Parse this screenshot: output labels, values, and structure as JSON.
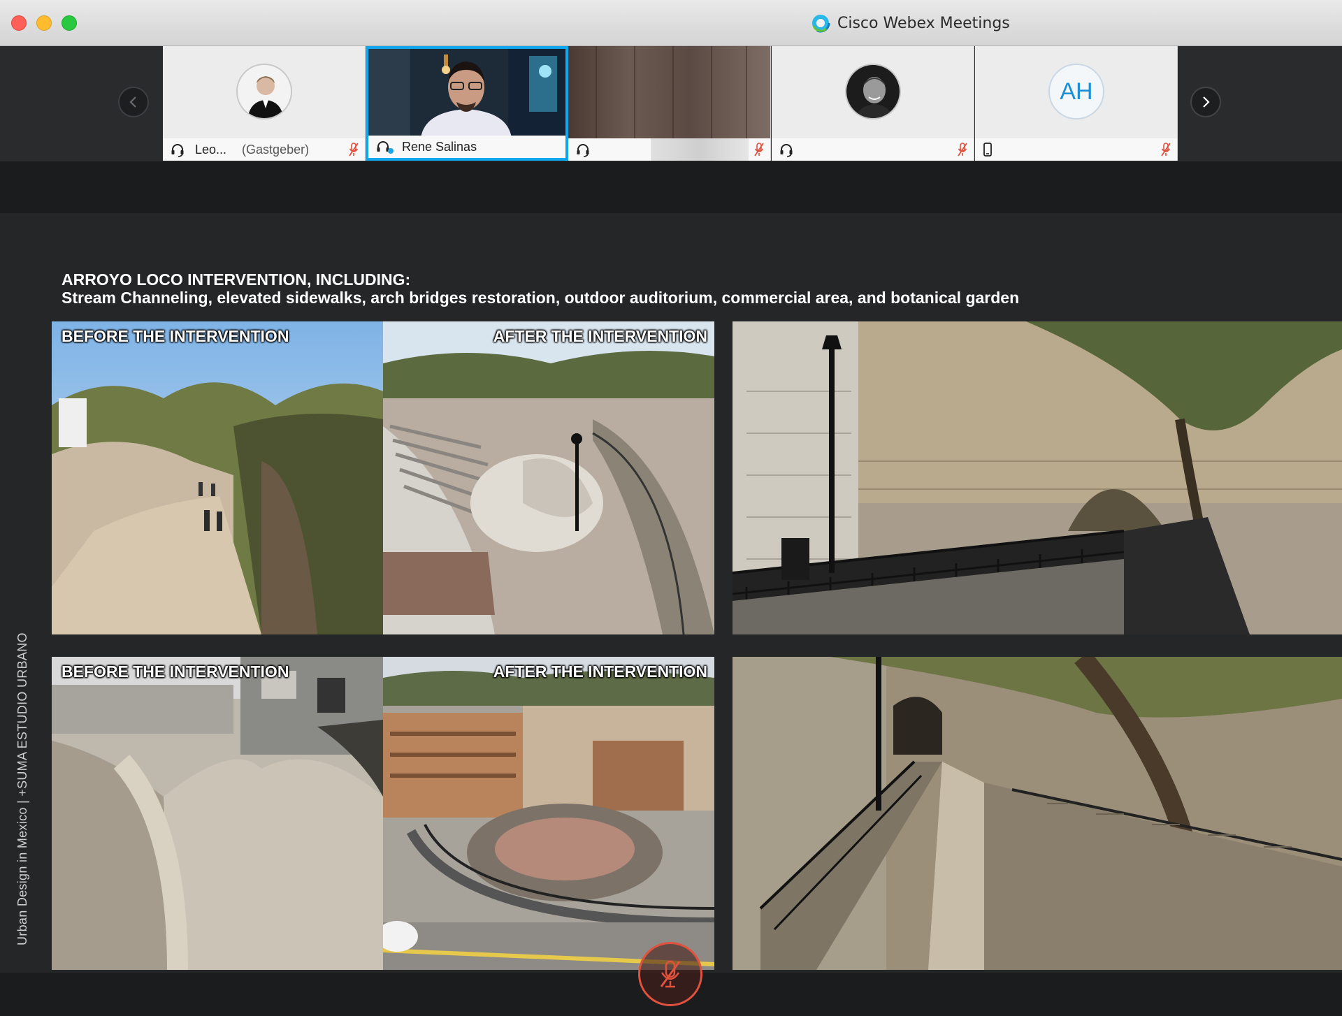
{
  "window": {
    "title": "Cisco Webex Meetings"
  },
  "participants": [
    {
      "name": "Leo...",
      "role": "(Gastgeber)",
      "audio_icon": "headset-icon",
      "muted": true
    },
    {
      "name": "Rene Salinas",
      "role": "",
      "audio_icon": "headset-active-icon",
      "muted": false,
      "active_speaker": true
    },
    {
      "name": "",
      "role": "",
      "audio_icon": "headset-icon",
      "muted": true
    },
    {
      "name": "",
      "role": "",
      "audio_icon": "headset-icon",
      "muted": true
    },
    {
      "name": "",
      "role": "",
      "initials": "AH",
      "audio_icon": "phone-icon",
      "muted": true
    }
  ],
  "slide": {
    "headline_line1": "ARROYO LOCO INTERVENTION, INCLUDING:",
    "headline_line2": "Stream Channeling, elevated sidewalks, arch bridges restoration, outdoor auditorium, commercial area, and botanical garden",
    "label_before": "BEFORE THE INTERVENTION",
    "label_after": "AFTER THE INTERVENTION",
    "vertical_caption": "Urban Design in Mexico  |  +SUMA ESTUDIO URBANO"
  },
  "colors": {
    "active_speaker_border": "#10a6ed",
    "mute_red": "#e0523d",
    "initials_blue": "#1a8fd6"
  }
}
